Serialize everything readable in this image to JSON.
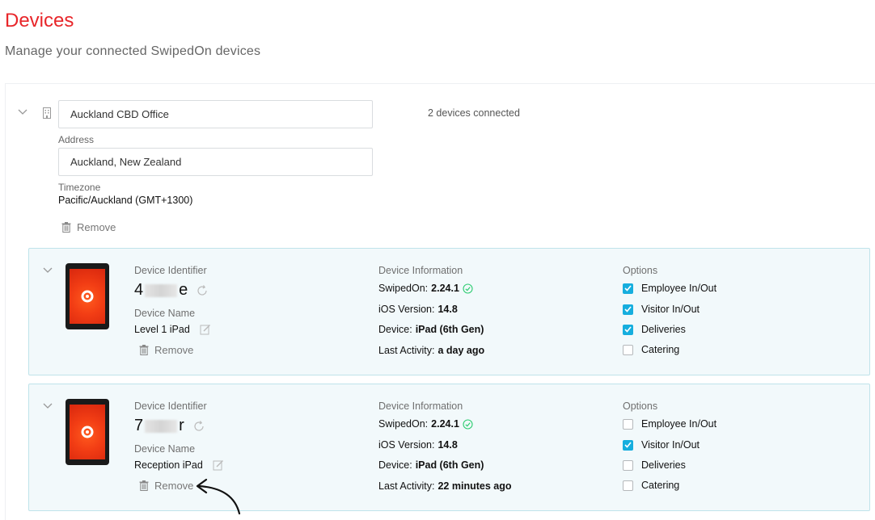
{
  "header": {
    "title": "Devices",
    "subtitle": "Manage your connected SwipedOn devices"
  },
  "location": {
    "name_value": "Auckland CBD Office",
    "address_label": "Address",
    "address_value": "Auckland, New Zealand",
    "timezone_label": "Timezone",
    "timezone_value": "Pacific/Auckland (GMT+1300)",
    "remove_label": "Remove",
    "devices_connected": "2 devices connected"
  },
  "labels": {
    "device_identifier": "Device Identifier",
    "device_name": "Device Name",
    "device_information": "Device Information",
    "options": "Options",
    "remove": "Remove",
    "swipedon_prefix": "SwipedOn:",
    "ios_prefix": "iOS Version:",
    "device_prefix": "Device:",
    "last_activity_prefix": "Last Activity:"
  },
  "devices": [
    {
      "identifier_start": "4",
      "identifier_end": "e",
      "name": "Level 1 iPad",
      "swipedon_version": "2.24.1",
      "ios_version": "14.8",
      "device_model": "iPad (6th Gen)",
      "last_activity": "a day ago",
      "options": [
        {
          "label": "Employee In/Out",
          "checked": true
        },
        {
          "label": "Visitor In/Out",
          "checked": true
        },
        {
          "label": "Deliveries",
          "checked": true
        },
        {
          "label": "Catering",
          "checked": false
        }
      ]
    },
    {
      "identifier_start": "7",
      "identifier_end": "r",
      "name": "Reception iPad",
      "swipedon_version": "2.24.1",
      "ios_version": "14.8",
      "device_model": "iPad (6th Gen)",
      "last_activity": "22 minutes ago",
      "options": [
        {
          "label": "Employee In/Out",
          "checked": false
        },
        {
          "label": "Visitor In/Out",
          "checked": true
        },
        {
          "label": "Deliveries",
          "checked": false
        },
        {
          "label": "Catering",
          "checked": false
        }
      ]
    }
  ],
  "colors": {
    "brand_red": "#e8262a",
    "checkbox_blue": "#16aede",
    "status_green": "#2ecc71",
    "card_border": "#bfe3ea",
    "card_bg": "#f2f9fb"
  },
  "icons": [
    "chevron-down-icon",
    "building-icon",
    "trash-icon",
    "refresh-icon",
    "edit-icon",
    "check-circle-icon",
    "checkmark-icon",
    "ipad-icon"
  ]
}
